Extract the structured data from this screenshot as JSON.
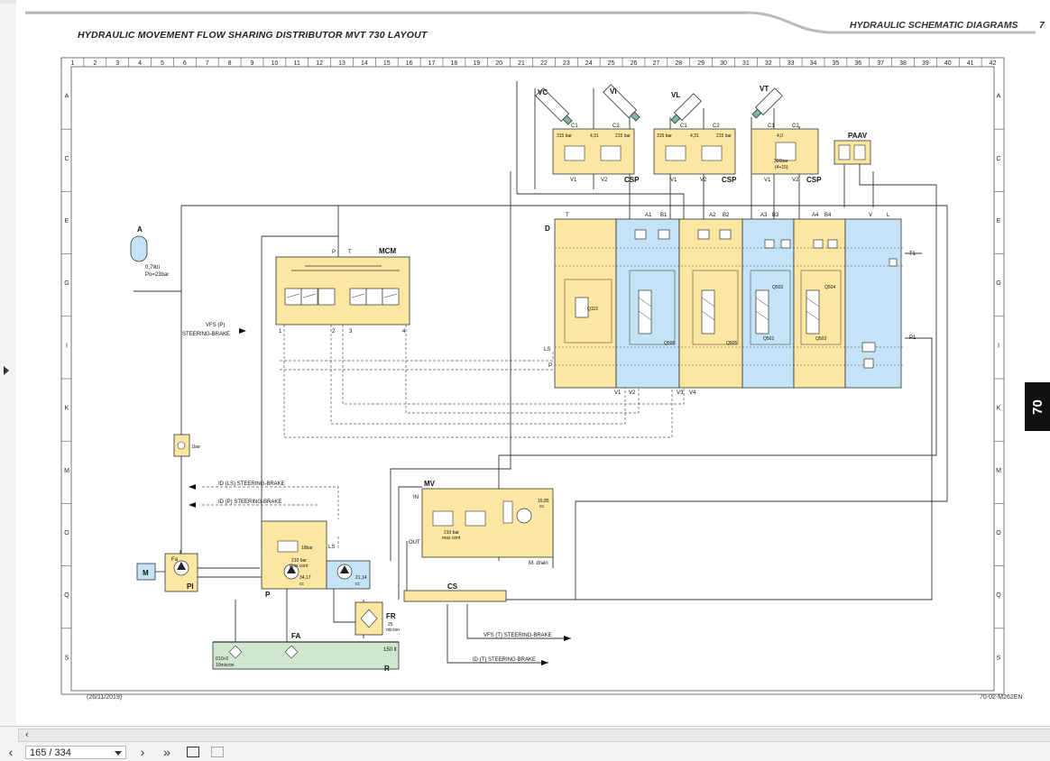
{
  "header": {
    "title": "HYDRAULIC MOVEMENT FLOW SHARING DISTRIBUTOR MVT 730 LAYOUT",
    "section": "HYDRAULIC SCHEMATIC DIAGRAMS",
    "page_number": "7",
    "chapter_tab": "70"
  },
  "footer": {
    "date": "(26/11/2019)",
    "code": "70-02-M262EN"
  },
  "grid": {
    "columns": [
      "1",
      "2",
      "3",
      "4",
      "5",
      "6",
      "7",
      "8",
      "9",
      "10",
      "11",
      "12",
      "13",
      "14",
      "15",
      "16",
      "17",
      "18",
      "19",
      "20",
      "21",
      "22",
      "23",
      "24",
      "25",
      "26",
      "27",
      "28",
      "29",
      "30",
      "31",
      "32",
      "33",
      "34",
      "35",
      "36",
      "37",
      "38",
      "39",
      "40",
      "41",
      "42"
    ],
    "rows": [
      "A",
      "C",
      "E",
      "G",
      "I",
      "K",
      "M",
      "O",
      "Q",
      "S"
    ]
  },
  "components": {
    "accumulator": {
      "label": "A",
      "spec_1": "0,7litri",
      "spec_2": "Po=23bar"
    },
    "mcm": {
      "label": "MCM",
      "port_p": "P",
      "port_t": "T",
      "ports": [
        "1",
        "2",
        "3",
        "4"
      ]
    },
    "distributor": {
      "label": "D",
      "top_ports": [
        "T",
        "A1",
        "B1",
        "A2",
        "B2",
        "A3",
        "B3",
        "A4",
        "B4",
        "V",
        "L"
      ],
      "side_ports": [
        "LS",
        "P"
      ],
      "right_ports": [
        "T1",
        "P1"
      ],
      "bottom_ports": [
        "V1",
        "V2",
        "V3",
        "V4"
      ],
      "sections": [
        "Q116",
        "Q506",
        "Q505",
        "Q502",
        "Q501",
        "Q504",
        "Q503"
      ]
    },
    "cylinders": [
      "VC",
      "VI",
      "VL",
      "VT"
    ],
    "csp_valves": [
      {
        "label": "CSP",
        "ports": [
          "C1",
          "C2",
          "V1",
          "V2"
        ],
        "spec_a": "315 bar",
        "spec_b": "4,31",
        "spec_c": "215 bar"
      },
      {
        "label": "CSP",
        "ports": [
          "C1",
          "C2",
          "V1",
          "V2"
        ],
        "spec_a": "315 bar",
        "spec_b": "4,31",
        "spec_c": "215 bar"
      },
      {
        "label": "CSP",
        "ports": [
          "C1",
          "C2",
          "V1",
          "V2"
        ],
        "spec_a": "4,0",
        "spec_b": "300bar",
        "spec_c": "(4+15)"
      }
    ],
    "paav": {
      "label": "PAAV"
    },
    "mv": {
      "label": "MV",
      "port_in": "IN",
      "port_out": "OUT",
      "spec_1": "210 bar",
      "spec_2": "max cont",
      "spec_3": "16,85",
      "spec_4": "cc",
      "drain": "M. drain"
    },
    "pump": {
      "label": "P",
      "port_ls": "LS",
      "spec_1": "18bar",
      "spec_2": "210 bar",
      "spec_3": "max cont",
      "spec_4": "34,17",
      "spec_5": "cc",
      "spec_6": "21,14",
      "spec_7": "cc"
    },
    "pi": {
      "label": "PI",
      "fa": "Fa"
    },
    "motor": {
      "label": "M"
    },
    "check_valve": {
      "spec": "1bar"
    },
    "cs": {
      "label": "CS"
    },
    "fr": {
      "label": "FR",
      "spec_1": "25",
      "spec_2": "micron"
    },
    "tank": {
      "label": "R",
      "fa_label": "FA",
      "volume": "150 lt",
      "spec_1": "ß10>2",
      "spec_2": "10micron"
    }
  },
  "signals": {
    "vfs_p": "VFS (P)",
    "steering_brake": "STEERING-BRAKE",
    "id_ls": "ID (LS) STEERING-BRAKE",
    "id_p": "ID (P) STEERING-BRAKE",
    "vfs_t": "VFS (T) STEERING-BRAKE",
    "id_t": "ID (T) STEERING-BRAKE"
  },
  "viewer": {
    "page_indicator": "165 / 334"
  },
  "colors": {
    "valve_yellow": "#fbe7a1",
    "section_blue": "#c5e3f6",
    "tank_green": "#cfe7cf",
    "line": "#333333"
  }
}
